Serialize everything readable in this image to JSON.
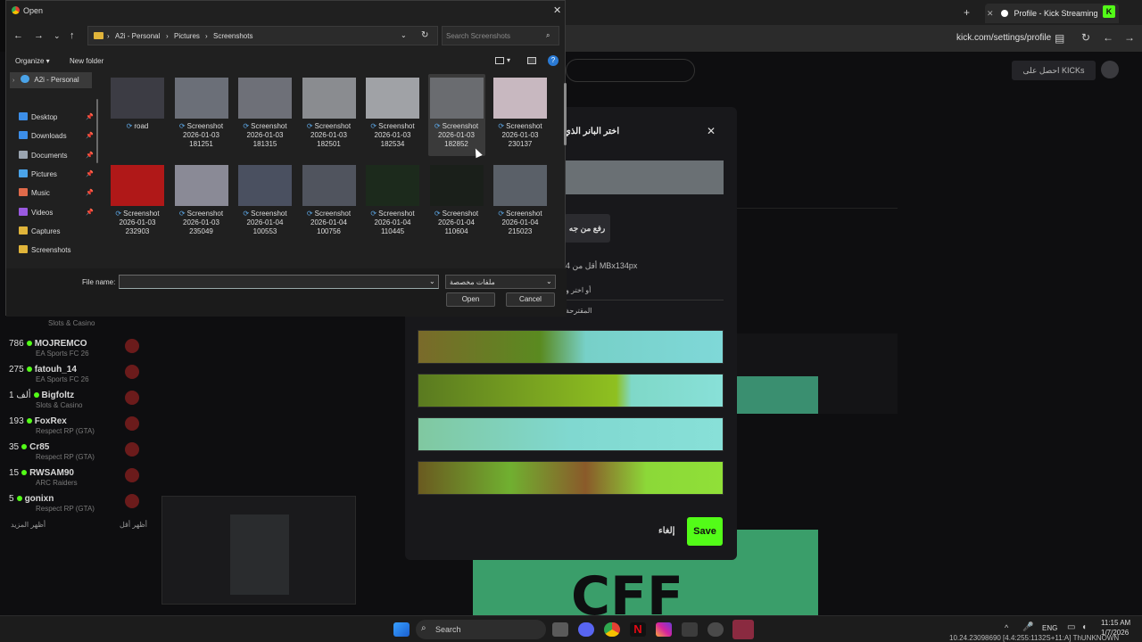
{
  "browser": {
    "tab_title": "Profile - Kick Streaming",
    "url": "kick.com/settings/profile"
  },
  "kick": {
    "kicks_button": "احصل على KICKs",
    "streamers": [
      {
        "viewers": "786",
        "name": "MOJREMCO",
        "category": "EA Sports FC 26"
      },
      {
        "viewers": "275",
        "name": "fatouh_14",
        "category": "EA Sports FC 26"
      },
      {
        "viewers": "1 ألف",
        "name": "Bigfoltz",
        "category": "Slots & Casino"
      },
      {
        "viewers": "193",
        "name": "FoxRex",
        "category": "Respect RP (GTA)"
      },
      {
        "viewers": "35",
        "name": "Cr85",
        "category": "Respect RP (GTA)"
      },
      {
        "viewers": "15",
        "name": "RWSAM90",
        "category": "ARC Raiders"
      },
      {
        "viewers": "5",
        "name": "gonixn",
        "category": "Respect RP (GTA)"
      }
    ],
    "prev_category": "Slots & Casino",
    "show_more": "أظهر المزيد",
    "show_less": "أظهر أقل"
  },
  "modal": {
    "title": "اختر البانر الذي",
    "upload_label": "رفع من جه",
    "size_hint": "4 أقل من MBx134px",
    "or_choose": "أو اختر و",
    "suggested": "المقترحة ",
    "cancel_label": "إلغاء",
    "save_label": "Save",
    "close_glyph": "✕"
  },
  "dialog": {
    "title": "Open",
    "breadcrumb": [
      "A2i - Personal",
      "Pictures",
      "Screenshots"
    ],
    "search_placeholder": "Search Screenshots",
    "organize": "Organize ▾",
    "new_folder": "New folder",
    "nav_root": "A2i - Personal",
    "nav_items": [
      {
        "label": "Desktop",
        "color": "#3c8ee8",
        "pinned": true
      },
      {
        "label": "Downloads",
        "color": "#3c8ee8",
        "pinned": true
      },
      {
        "label": "Documents",
        "color": "#9aa4b0",
        "pinned": true
      },
      {
        "label": "Pictures",
        "color": "#4aa3e8",
        "pinned": true
      },
      {
        "label": "Music",
        "color": "#e06a4a",
        "pinned": true
      },
      {
        "label": "Videos",
        "color": "#9a5ae0",
        "pinned": true
      },
      {
        "label": "Captures",
        "color": "#e0b43a",
        "pinned": false
      },
      {
        "label": "Screenshots",
        "color": "#e0b43a",
        "pinned": false
      }
    ],
    "files": [
      {
        "l1": "road",
        "l2": "",
        "l3": "",
        "thumb": "#3c3c44"
      },
      {
        "l1": "Screenshot",
        "l2": "2026-01-03",
        "l3": "181251",
        "thumb": "#6b6f78"
      },
      {
        "l1": "Screenshot",
        "l2": "2026-01-03",
        "l3": "181315",
        "thumb": "#6e7078"
      },
      {
        "l1": "Screenshot",
        "l2": "2026-01-03",
        "l3": "182501",
        "thumb": "#8a8c90"
      },
      {
        "l1": "Screenshot",
        "l2": "2026-01-03",
        "l3": "182534",
        "thumb": "#a0a2a6"
      },
      {
        "l1": "Screenshot",
        "l2": "2026-01-03",
        "l3": "182852",
        "thumb": "#6a6c70"
      },
      {
        "l1": "Screenshot",
        "l2": "2026-01-03",
        "l3": "230137",
        "thumb": "#c8b8c0"
      },
      {
        "l1": "Screenshot",
        "l2": "2026-01-03",
        "l3": "232903",
        "thumb": "#b01818"
      },
      {
        "l1": "Screenshot",
        "l2": "2026-01-03",
        "l3": "235049",
        "thumb": "#8a8a96"
      },
      {
        "l1": "Screenshot",
        "l2": "2026-01-04",
        "l3": "100553",
        "thumb": "#4a5060"
      },
      {
        "l1": "Screenshot",
        "l2": "2026-01-04",
        "l3": "100756",
        "thumb": "#50545e"
      },
      {
        "l1": "Screenshot",
        "l2": "2026-01-04",
        "l3": "110445",
        "thumb": "#1c2a1c"
      },
      {
        "l1": "Screenshot",
        "l2": "2026-01-04",
        "l3": "110604",
        "thumb": "#1a1f1a"
      },
      {
        "l1": "Screenshot",
        "l2": "2026-01-04",
        "l3": "215023",
        "thumb": "#5a6068"
      }
    ],
    "file_name_label": "File name:",
    "file_name_value": "",
    "file_type": "ملفات مخصصة",
    "open_label": "Open",
    "cancel_label": "Cancel"
  },
  "taskbar": {
    "search_label": "Search",
    "lang": "ENG",
    "time": "11:15 AM",
    "date": "1/7/2026",
    "status_line": "10.24.23098690 [4.4:255:1132S+11:A] ThUNKNOWN"
  },
  "colors": {
    "accent": "#53fc18",
    "dialog_bg": "#202020",
    "modal_bg": "#18181b"
  }
}
